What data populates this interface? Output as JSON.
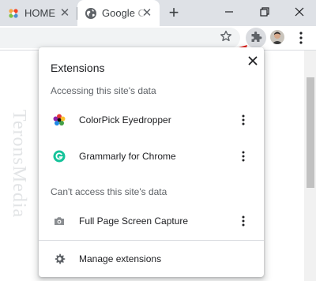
{
  "tabs": [
    {
      "label": "HOME",
      "icon": "joomla-icon"
    },
    {
      "label": "Google C",
      "icon": "globe-icon"
    }
  ],
  "toolbar": {
    "bookmark_icon": "star-icon",
    "extensions_icon": "puzzle-icon",
    "menu_icon": "more-vert-icon"
  },
  "page": {
    "watermark": "TeronsMedia"
  },
  "popup": {
    "title": "Extensions",
    "accessing_heading": "Accessing this site's data",
    "cant_access_heading": "Can't access this site's data",
    "accessing_items": [
      {
        "name": "ColorPick Eyedropper",
        "icon": "colorpick-icon"
      },
      {
        "name": "Grammarly for Chrome",
        "icon": "grammarly-icon"
      }
    ],
    "cant_access_items": [
      {
        "name": "Full Page Screen Capture",
        "icon": "camera-icon"
      }
    ],
    "manage_label": "Manage extensions"
  },
  "colors": {
    "tab_strip_bg": "#dee1e6",
    "annotation_arrow": "#e0201b",
    "grammarly_green": "#15c39a"
  }
}
